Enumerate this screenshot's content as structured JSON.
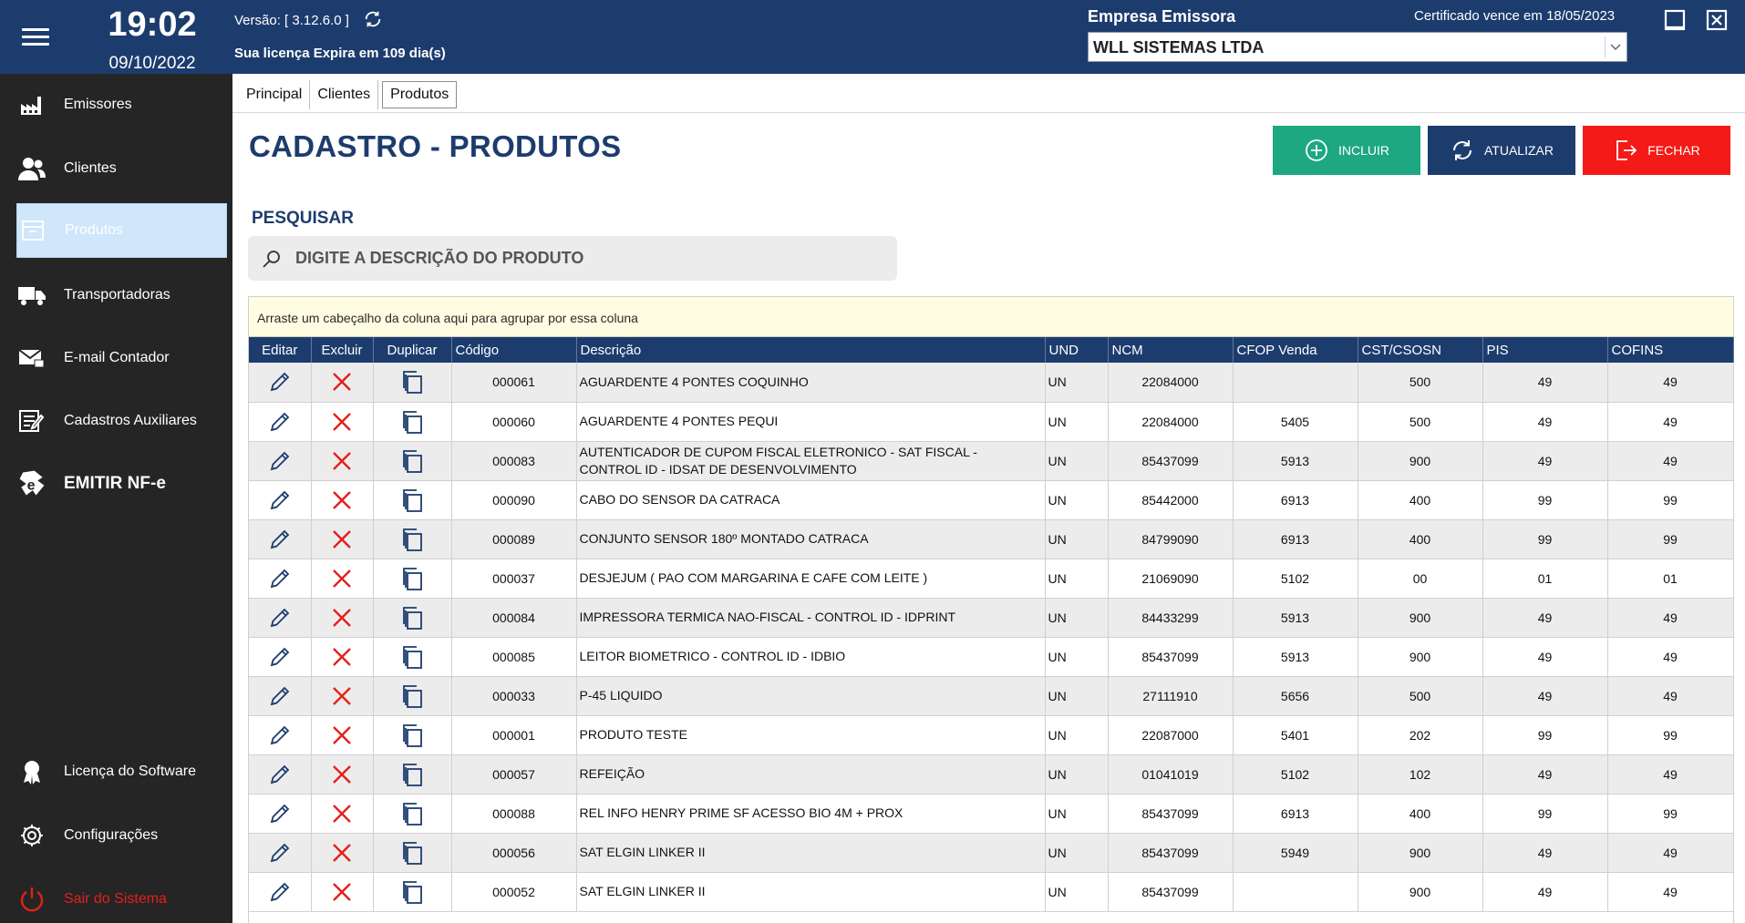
{
  "header": {
    "time": "19:02",
    "date": "09/10/2022",
    "version": "Versão: [ 3.12.6.0 ]",
    "license": "Sua licença Expira em 109 dia(s)",
    "empresa_label": "Empresa Emissora",
    "cert_expiry": "Certificado vence em 18/05/2023",
    "empresa_selected": "WLL SISTEMAS LTDA"
  },
  "sidebar": {
    "items": [
      {
        "label": "Emissores",
        "icon": "factory-icon"
      },
      {
        "label": "Clientes",
        "icon": "users-icon"
      },
      {
        "label": "Produtos",
        "icon": "box-icon"
      },
      {
        "label": "Transportadoras",
        "icon": "truck-icon"
      },
      {
        "label": "E-mail Contador",
        "icon": "mail-icon"
      },
      {
        "label": "Cadastros Auxiliares",
        "icon": "notes-icon"
      },
      {
        "label": "EMITIR NF-e",
        "icon": "nfe-icon"
      }
    ],
    "bottom": [
      {
        "label": "Licença do Software",
        "icon": "award-icon"
      },
      {
        "label": "Configurações",
        "icon": "gear-icon"
      },
      {
        "label": "Sair do Sistema",
        "icon": "power-icon"
      }
    ]
  },
  "tabs": [
    "Principal",
    "Clientes",
    "Produtos"
  ],
  "page": {
    "title": "CADASTRO - PRODUTOS",
    "btn_incluir": "INCLUIR",
    "btn_atualizar": "ATUALIZAR",
    "btn_fechar": "FECHAR",
    "search_label": "PESQUISAR",
    "search_placeholder": "DIGITE A DESCRIÇÃO DO PRODUTO",
    "group_hint": "Arraste um cabeçalho da coluna aqui para agrupar por essa coluna"
  },
  "colors": {
    "primary": "#1d3c6e",
    "incluir": "#1ea882",
    "fechar": "#f41a17",
    "sidebar": "#252525"
  },
  "grid": {
    "columns": [
      "Editar",
      "Excluir",
      "Duplicar",
      "Código",
      "Descrição",
      "UND",
      "NCM",
      "CFOP Venda",
      "CST/CSOSN",
      "PIS",
      "COFINS"
    ],
    "rows": [
      {
        "codigo": "000061",
        "descricao": "AGUARDENTE 4 PONTES COQUINHO",
        "und": "UN",
        "ncm": "22084000",
        "cfop": "",
        "cst": "500",
        "pis": "49",
        "cofins": "49"
      },
      {
        "codigo": "000060",
        "descricao": "AGUARDENTE 4 PONTES PEQUI",
        "und": "UN",
        "ncm": "22084000",
        "cfop": "5405",
        "cst": "500",
        "pis": "49",
        "cofins": "49"
      },
      {
        "codigo": "000083",
        "descricao": "AUTENTICADOR DE CUPOM FISCAL ELETRONICO - SAT FISCAL - CONTROL ID - IDSAT DE DESENVOLVIMENTO",
        "und": "UN",
        "ncm": "85437099",
        "cfop": "5913",
        "cst": "900",
        "pis": "49",
        "cofins": "49"
      },
      {
        "codigo": "000090",
        "descricao": "CABO DO SENSOR DA CATRACA",
        "und": "UN",
        "ncm": "85442000",
        "cfop": "6913",
        "cst": "400",
        "pis": "99",
        "cofins": "99"
      },
      {
        "codigo": "000089",
        "descricao": "CONJUNTO SENSOR 180º MONTADO CATRACA",
        "und": "UN",
        "ncm": "84799090",
        "cfop": "6913",
        "cst": "400",
        "pis": "99",
        "cofins": "99"
      },
      {
        "codigo": "000037",
        "descricao": "DESJEJUM ( PAO COM MARGARINA E CAFE COM LEITE )",
        "und": "UN",
        "ncm": "21069090",
        "cfop": "5102",
        "cst": "00",
        "pis": "01",
        "cofins": "01"
      },
      {
        "codigo": "000084",
        "descricao": "IMPRESSORA TERMICA NAO-FISCAL - CONTROL ID - IDPRINT",
        "und": "UN",
        "ncm": "84433299",
        "cfop": "5913",
        "cst": "900",
        "pis": "49",
        "cofins": "49"
      },
      {
        "codigo": "000085",
        "descricao": "LEITOR BIOMETRICO - CONTROL ID - IDBIO",
        "und": "UN",
        "ncm": "85437099",
        "cfop": "5913",
        "cst": "900",
        "pis": "49",
        "cofins": "49"
      },
      {
        "codigo": "000033",
        "descricao": "P-45 LIQUIDO",
        "und": "UN",
        "ncm": "27111910",
        "cfop": "5656",
        "cst": "500",
        "pis": "49",
        "cofins": "49"
      },
      {
        "codigo": "000001",
        "descricao": "PRODUTO TESTE",
        "und": "UN",
        "ncm": "22087000",
        "cfop": "5401",
        "cst": "202",
        "pis": "99",
        "cofins": "99"
      },
      {
        "codigo": "000057",
        "descricao": "REFEIÇÃO",
        "und": "UN",
        "ncm": "01041019",
        "cfop": "5102",
        "cst": "102",
        "pis": "49",
        "cofins": "49"
      },
      {
        "codigo": "000088",
        "descricao": "REL INFO HENRY PRIME SF ACESSO BIO 4M + PROX",
        "und": "UN",
        "ncm": "85437099",
        "cfop": "6913",
        "cst": "400",
        "pis": "99",
        "cofins": "99"
      },
      {
        "codigo": "000056",
        "descricao": "SAT ELGIN LINKER II",
        "und": "UN",
        "ncm": "85437099",
        "cfop": "5949",
        "cst": "900",
        "pis": "49",
        "cofins": "49"
      },
      {
        "codigo": "000052",
        "descricao": "SAT ELGIN LINKER II",
        "und": "UN",
        "ncm": "85437099",
        "cfop": "",
        "cst": "900",
        "pis": "49",
        "cofins": "49"
      }
    ]
  }
}
